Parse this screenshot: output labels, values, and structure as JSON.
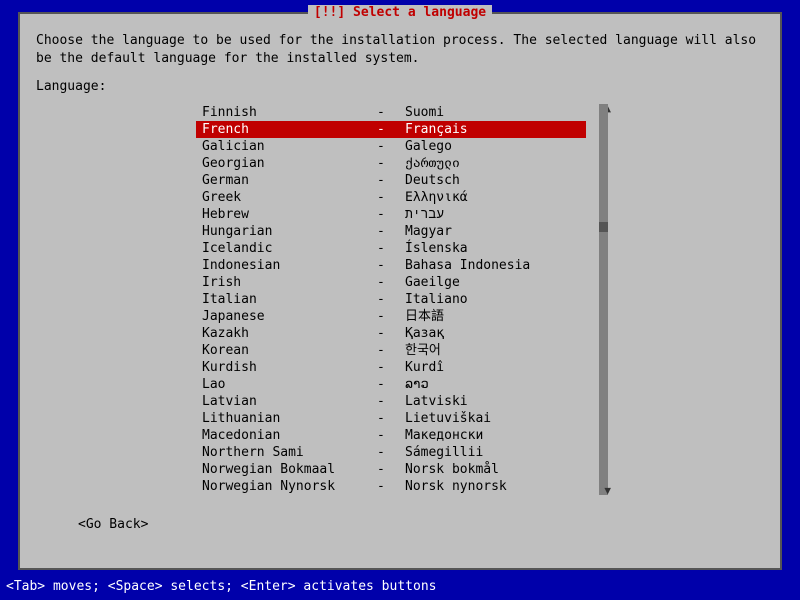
{
  "dialog": {
    "title": "[!!] Select a language",
    "intro": "Choose the language to be used for the installation process. The selected language will also be the default language for the installed system.",
    "label": "Language:",
    "go_back": "<Go Back>"
  },
  "languages": [
    {
      "en": "Finnish",
      "native": "Suomi",
      "selected": false
    },
    {
      "en": "French",
      "native": "Français",
      "selected": true
    },
    {
      "en": "Galician",
      "native": "Galego",
      "selected": false
    },
    {
      "en": "Georgian",
      "native": "ქართული",
      "selected": false
    },
    {
      "en": "German",
      "native": "Deutsch",
      "selected": false
    },
    {
      "en": "Greek",
      "native": "Ελληνικά",
      "selected": false
    },
    {
      "en": "Hebrew",
      "native": "עברית",
      "selected": false
    },
    {
      "en": "Hungarian",
      "native": "Magyar",
      "selected": false
    },
    {
      "en": "Icelandic",
      "native": "Íslenska",
      "selected": false
    },
    {
      "en": "Indonesian",
      "native": "Bahasa Indonesia",
      "selected": false
    },
    {
      "en": "Irish",
      "native": "Gaeilge",
      "selected": false
    },
    {
      "en": "Italian",
      "native": "Italiano",
      "selected": false
    },
    {
      "en": "Japanese",
      "native": "日本語",
      "selected": false
    },
    {
      "en": "Kazakh",
      "native": "Қазақ",
      "selected": false
    },
    {
      "en": "Korean",
      "native": "한국어",
      "selected": false
    },
    {
      "en": "Kurdish",
      "native": "Kurdî",
      "selected": false
    },
    {
      "en": "Lao",
      "native": "ລາວ",
      "selected": false
    },
    {
      "en": "Latvian",
      "native": "Latviski",
      "selected": false
    },
    {
      "en": "Lithuanian",
      "native": "Lietuviškai",
      "selected": false
    },
    {
      "en": "Macedonian",
      "native": "Македонски",
      "selected": false
    },
    {
      "en": "Northern Sami",
      "native": "Sámegillii",
      "selected": false
    },
    {
      "en": "Norwegian Bokmaal",
      "native": "Norsk bokmål",
      "selected": false
    },
    {
      "en": "Norwegian Nynorsk",
      "native": "Norsk nynorsk",
      "selected": false
    }
  ],
  "footer": "<Tab> moves; <Space> selects; <Enter> activates buttons"
}
